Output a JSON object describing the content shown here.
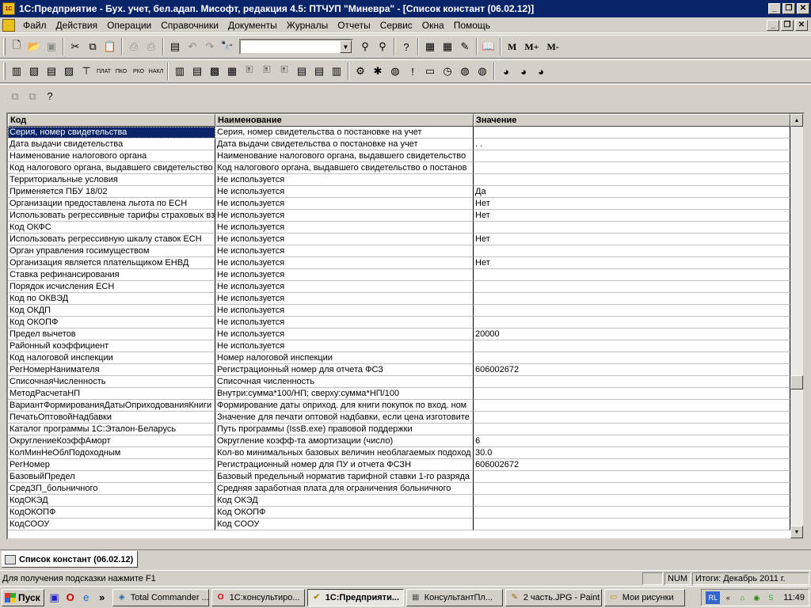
{
  "title": "1С:Предприятие - Бух. учет, бел.адап. Мисофт, редакция 4.5: ПТЧУП \"Миневра\" - [Список констант (06.02.12)]",
  "menu": [
    "Файл",
    "Действия",
    "Операции",
    "Справочники",
    "Документы",
    "Журналы",
    "Отчеты",
    "Сервис",
    "Окна",
    "Помощь"
  ],
  "toolbar": {
    "m_label": "M",
    "mplus_label": "M+",
    "mminus_label": "M-",
    "combo_value": ""
  },
  "toolbar_small_labels": [
    "ПЛАТ",
    "ПКО",
    "РКО",
    "НАКЛ"
  ],
  "grid": {
    "columns": [
      "Код",
      "Наименование",
      "Значение"
    ],
    "rows": [
      [
        "Серия, номер свидетельства",
        "Серия, номер свидетельства о постановке на учет",
        ""
      ],
      [
        "Дата выдачи свидетельства",
        "Дата выдачи свидетельства о постановке на учет",
        "  .  ."
      ],
      [
        "Наименование налогового органа",
        "Наименование налогового органа, выдавшего свидетельство",
        ""
      ],
      [
        "Код налогового органа, выдавшего свидетельство",
        "Код налогового органа, выдавшего свидетельство о постанов",
        ""
      ],
      [
        "Территориальные условия",
        "Не используется",
        ""
      ],
      [
        "Применяется ПБУ 18/02",
        "Не используется",
        "Да"
      ],
      [
        "Организации предоставлена льгота по ЕСН",
        "Не используется",
        "Нет"
      ],
      [
        "Использовать регрессивные тарифы страховых взносов",
        "Не используется",
        "Нет"
      ],
      [
        "Код ОКФС",
        "Не используется",
        ""
      ],
      [
        "Использовать регрессивную шкалу ставок ЕСН",
        "Не используется",
        "Нет"
      ],
      [
        "Орган управления госимуществом",
        "Не используется",
        ""
      ],
      [
        "Организация является плательщиком ЕНВД",
        "Не используется",
        "Нет"
      ],
      [
        "Ставка рефинансирования",
        "Не используется",
        ""
      ],
      [
        "Порядок исчисления ЕСН",
        "Не используется",
        ""
      ],
      [
        "Код по ОКВЭД",
        "Не используется",
        ""
      ],
      [
        "Код ОКДП",
        "Не используется",
        ""
      ],
      [
        "Код ОКОПФ",
        "Не используется",
        ""
      ],
      [
        "Предел вычетов",
        "Не используется",
        "20000"
      ],
      [
        "Районный коэффициент",
        "Не используется",
        ""
      ],
      [
        "Код налоговой инспекции",
        "Номер налоговой инспекции",
        ""
      ],
      [
        "РегНомерНанимателя",
        "Регистрационный номер для отчета ФСЗ",
        "606002672"
      ],
      [
        "СписочнаяЧисленность",
        "Списочная численность",
        ""
      ],
      [
        "МетодРасчетаНП",
        "Внутри:сумма*100/НП; сверху:сумма*НП/100",
        ""
      ],
      [
        "ВариантФормированияДатыОприходованияКниги",
        "Формирование даты оприход. для книги покупок по вход. ном",
        ""
      ],
      [
        "ПечатьОптовойНадбавки",
        "Значение для печати оптовой надбавки, если цена изготовите",
        ""
      ],
      [
        "Каталог программы 1С:Эталон-Беларусь",
        "Путь программы (IssB.exe) правовой поддержки",
        ""
      ],
      [
        "ОкруглениеКоэффАморт",
        "Округление коэфф-та амортизации (число)",
        "6"
      ],
      [
        "КолМинНеОблПодоходным",
        "Кол-во минимальных базовых величин необлагаемых подоход",
        "30.0"
      ],
      [
        "РегНомер",
        "Регистрационный номер для ПУ и отчета ФСЗН",
        "606002672"
      ],
      [
        "БазовыйПредел",
        "Базовый предельный норматив тарифной ставки 1-го разряда",
        ""
      ],
      [
        "СредЗП_больничного",
        "Средняя заработная плата для ограничения больничного",
        ""
      ],
      [
        "КодОКЭД",
        "Код ОКЭД",
        ""
      ],
      [
        "КодОКОПФ",
        "Код ОКОПФ",
        ""
      ],
      [
        "КодСООУ",
        "Код СООУ",
        ""
      ]
    ]
  },
  "window_tab": "Список констант (06.02.12)",
  "status": {
    "hint": "Для получения подсказки нажмите F1",
    "num": "NUM",
    "totals": "Итоги: Декабрь 2011 г."
  },
  "taskbar": {
    "start": "Пуск",
    "more": "»",
    "items": [
      "Total Commander ...",
      "1С:консультиро...",
      "1С:Предприяти...",
      "КонсультантПл...",
      "2 часть.JPG - Paint",
      "Мои рисунки"
    ],
    "lang": "RL",
    "arrow": "«",
    "clock": "11:49"
  }
}
